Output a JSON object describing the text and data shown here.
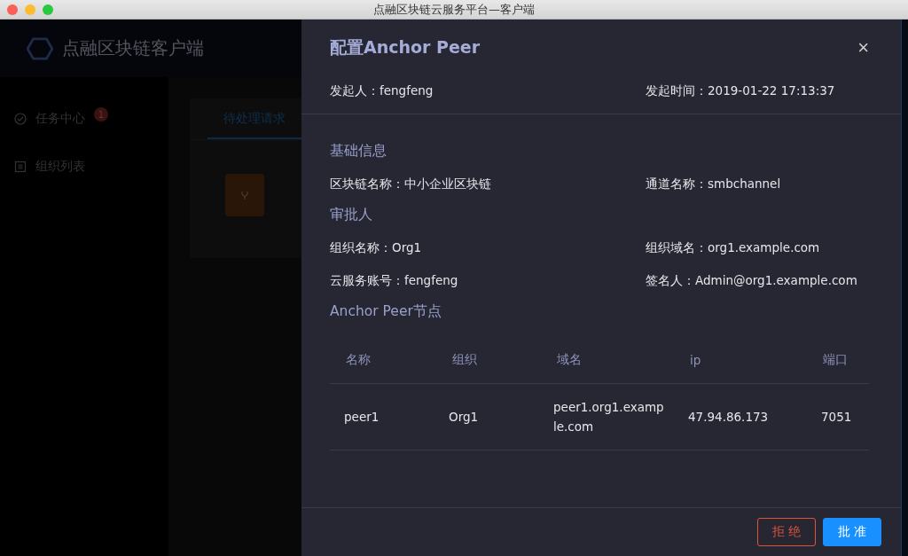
{
  "window": {
    "title": "点融区块链云服务平台—客户端"
  },
  "app": {
    "logo_text": "点融区块链客户端",
    "sidebar": {
      "items": [
        {
          "label": "任务中心",
          "badge": "1",
          "kind": "task"
        },
        {
          "label": "组织列表",
          "kind": "org"
        }
      ]
    },
    "tabs": [
      {
        "label": "待处理请求",
        "selected": true
      }
    ]
  },
  "drawer": {
    "title": "配置Anchor Peer",
    "close": "×",
    "meta": [
      {
        "label": "发起人：",
        "value": "fengfeng"
      },
      {
        "label": "发起时间：",
        "value": "2019-01-22 17:13:37"
      }
    ],
    "sections": [
      {
        "heading": "基础信息",
        "fields": [
          {
            "label": "区块链名称：",
            "value": "中小企业区块链"
          },
          {
            "label": "通道名称：",
            "value": "smbchannel"
          }
        ]
      },
      {
        "heading": "审批人",
        "fields": [
          {
            "label": "组织名称：",
            "value": "Org1"
          },
          {
            "label": "组织域名：",
            "value": "org1.example.com"
          },
          {
            "label": "云服务账号：",
            "value": "fengfeng"
          },
          {
            "label": "签名人：",
            "value": "Admin@org1.example.com"
          }
        ]
      }
    ],
    "table": {
      "heading": "Anchor Peer节点",
      "columns": [
        "名称",
        "组织",
        "域名",
        "ip",
        "端口"
      ],
      "rows": [
        [
          "peer1",
          "Org1",
          "peer1.org1.example.com",
          "47.94.86.173",
          "7051"
        ]
      ]
    },
    "buttons": [
      {
        "label": "拒 绝",
        "kind": "danger"
      },
      {
        "label": "批 准",
        "kind": "primary"
      }
    ]
  }
}
